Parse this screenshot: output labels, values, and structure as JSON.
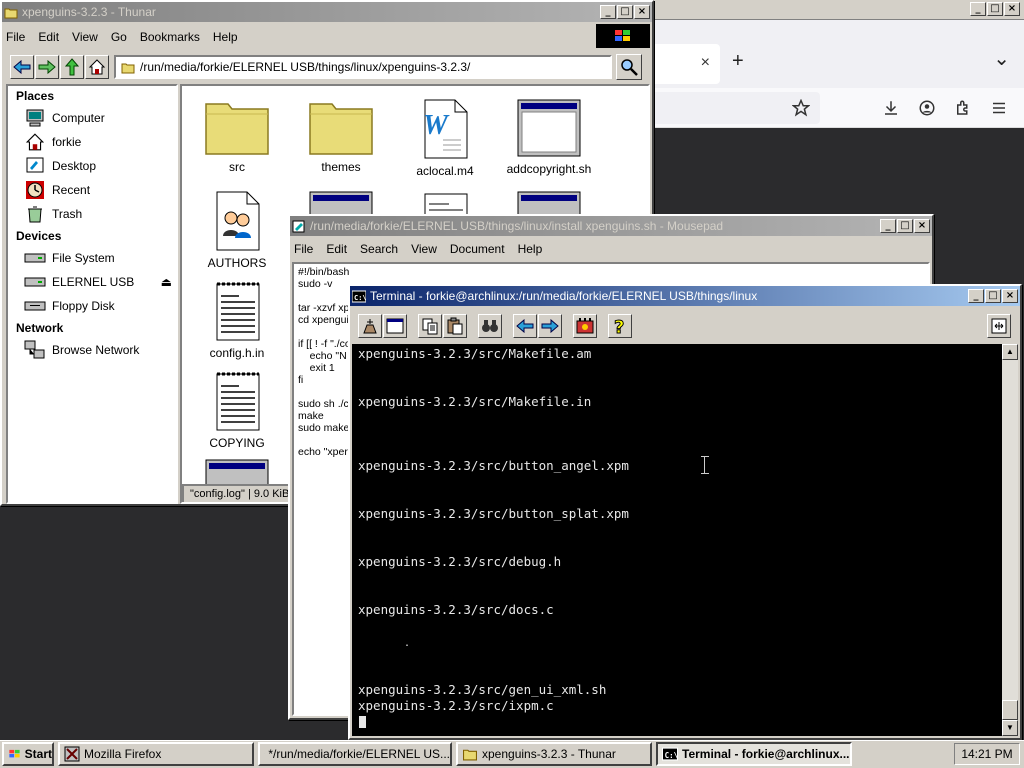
{
  "firefox": {
    "title_buttons": [
      "_",
      "□",
      "×"
    ],
    "tab_close": "×",
    "new_tab": "+",
    "tab_list": "⌄"
  },
  "thunar": {
    "title": "xpenguins-3.2.3 - Thunar",
    "menu": [
      "File",
      "Edit",
      "View",
      "Go",
      "Bookmarks",
      "Help"
    ],
    "path": "/run/media/forkie/ELERNEL USB/things/linux/xpenguins-3.2.3/",
    "sidebar": {
      "places_label": "Places",
      "places": [
        "Computer",
        "forkie",
        "Desktop",
        "Recent",
        "Trash"
      ],
      "devices_label": "Devices",
      "devices": [
        "File System",
        "ELERNEL USB",
        "Floppy Disk"
      ],
      "network_label": "Network",
      "network": [
        "Browse Network"
      ]
    },
    "files": [
      "src",
      "themes",
      "aclocal.m4",
      "addcopyright.sh",
      "AUTHORS",
      "config.h.in",
      "COPYING"
    ],
    "status": "\"config.log\" | 9.0 KiB"
  },
  "mousepad": {
    "title": "/run/media/forkie/ELERNEL USB/things/linux/install xpenguins.sh - Mousepad",
    "menu": [
      "File",
      "Edit",
      "Search",
      "View",
      "Document",
      "Help"
    ],
    "lines": [
      "#!/bin/bash",
      "sudo -v",
      "",
      "tar -xzvf xp",
      "cd xpengui",
      "",
      "if [[ ! -f \"./co",
      "    echo \"N",
      "    exit 1",
      "fi",
      "",
      "sudo sh ./c",
      "make",
      "sudo make",
      "",
      "echo \"xper"
    ]
  },
  "terminal": {
    "title": "Terminal - forkie@archlinux:/run/media/forkie/ELERNEL USB/things/linux",
    "lines": [
      "xpenguins-3.2.3/src/Makefile.am",
      "xpenguins-3.2.3/src/Makefile.in",
      "xpenguins-3.2.3/src/button_angel.xpm",
      "xpenguins-3.2.3/src/button_splat.xpm",
      "xpenguins-3.2.3/src/debug.h",
      "xpenguins-3.2.3/src/docs.c",
      ".",
      "xpenguins-3.2.3/src/gen_ui_xml.sh",
      "xpenguins-3.2.3/src/ixpm.c"
    ]
  },
  "taskbar": {
    "start": "Start",
    "tasks": [
      "Mozilla Firefox",
      "*/run/media/forkie/ELERNEL US...",
      "xpenguins-3.2.3 - Thunar",
      "Terminal - forkie@archlinux..."
    ],
    "clock": "14:21 PM"
  }
}
